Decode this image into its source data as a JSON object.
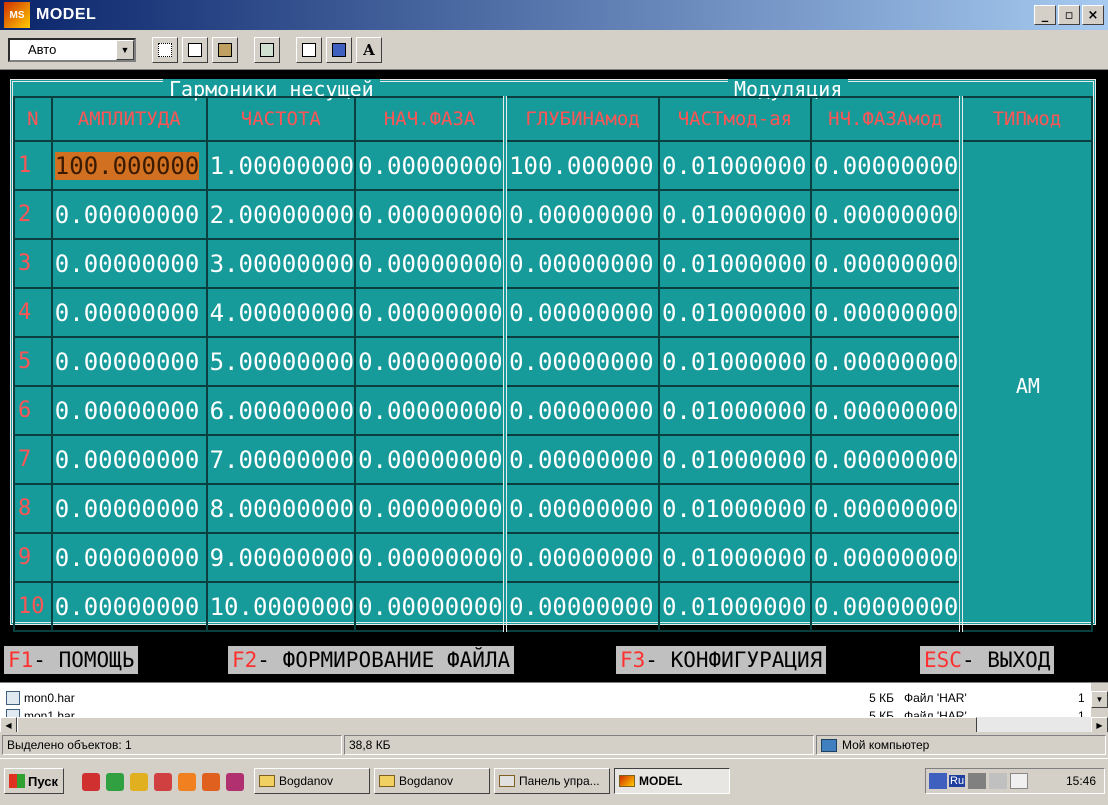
{
  "window": {
    "title": "MODEL",
    "icon_text": "MS"
  },
  "toolbar": {
    "font_value": "Авто",
    "buttons": [
      "mark-icon",
      "copy-icon",
      "paste-icon",
      "fullscreen-icon",
      "properties-icon",
      "background-icon",
      "font-icon"
    ],
    "font_btn_label": "A"
  },
  "screen": {
    "group_carrier": "Гармоники несущей",
    "group_mod": "Модуляция",
    "headers": {
      "n": "N",
      "amp": "АМПЛИТУДА",
      "freq": "ЧАСТОТА",
      "phase": "НАЧ.ФАЗА",
      "depth": "ГЛУБИНАмод",
      "modfreq": "ЧАСТмод-ая",
      "modphase": "НЧ.ФАЗАмод",
      "type": "ТИПмод"
    },
    "rows": [
      {
        "n": "1",
        "amp": "100.000000",
        "freq": "1.00000000",
        "phase": "0.00000000",
        "depth": "100.000000",
        "modfreq": "0.01000000",
        "modphase": "0.00000000"
      },
      {
        "n": "2",
        "amp": "0.00000000",
        "freq": "2.00000000",
        "phase": "0.00000000",
        "depth": "0.00000000",
        "modfreq": "0.01000000",
        "modphase": "0.00000000"
      },
      {
        "n": "3",
        "amp": "0.00000000",
        "freq": "3.00000000",
        "phase": "0.00000000",
        "depth": "0.00000000",
        "modfreq": "0.01000000",
        "modphase": "0.00000000"
      },
      {
        "n": "4",
        "amp": "0.00000000",
        "freq": "4.00000000",
        "phase": "0.00000000",
        "depth": "0.00000000",
        "modfreq": "0.01000000",
        "modphase": "0.00000000"
      },
      {
        "n": "5",
        "amp": "0.00000000",
        "freq": "5.00000000",
        "phase": "0.00000000",
        "depth": "0.00000000",
        "modfreq": "0.01000000",
        "modphase": "0.00000000"
      },
      {
        "n": "6",
        "amp": "0.00000000",
        "freq": "6.00000000",
        "phase": "0.00000000",
        "depth": "0.00000000",
        "modfreq": "0.01000000",
        "modphase": "0.00000000"
      },
      {
        "n": "7",
        "amp": "0.00000000",
        "freq": "7.00000000",
        "phase": "0.00000000",
        "depth": "0.00000000",
        "modfreq": "0.01000000",
        "modphase": "0.00000000"
      },
      {
        "n": "8",
        "amp": "0.00000000",
        "freq": "8.00000000",
        "phase": "0.00000000",
        "depth": "0.00000000",
        "modfreq": "0.01000000",
        "modphase": "0.00000000"
      },
      {
        "n": "9",
        "amp": "0.00000000",
        "freq": "9.00000000",
        "phase": "0.00000000",
        "depth": "0.00000000",
        "modfreq": "0.01000000",
        "modphase": "0.00000000"
      },
      {
        "n": "10",
        "amp": "0.00000000",
        "freq": "10.0000000",
        "phase": "0.00000000",
        "depth": "0.00000000",
        "modfreq": "0.01000000",
        "modphase": "0.00000000"
      }
    ],
    "type_value": "AM",
    "fkeys": [
      {
        "key": "F1",
        "label": " - ПОМОЩЬ"
      },
      {
        "key": "F2",
        "label": " - ФОРМИРОВАНИЕ ФАЙЛА"
      },
      {
        "key": "F3",
        "label": " - КОНФИГУРАЦИЯ"
      },
      {
        "key": "ESC",
        "label": " - ВЫХОД"
      }
    ]
  },
  "files": [
    {
      "name": "mon0.har",
      "size": "5 КБ",
      "type": "Файл 'HAR'",
      "date": "1"
    },
    {
      "name": "mon1.har",
      "size": "5 КБ",
      "type": "Файл 'HAR'",
      "date": "1"
    }
  ],
  "status": {
    "selected": "Выделено объектов: 1",
    "size": "38,8 КБ",
    "location": "Мой компьютер"
  },
  "taskbar": {
    "start": "Пуск",
    "tasks": [
      "Bogdanov",
      "Bogdanov",
      "Панель упра...",
      "MODEL"
    ],
    "tray_lang": "Ru",
    "clock": "15:46"
  },
  "colors": {
    "dos_bg": "#169a9a",
    "header_text": "#ff5555",
    "selected_cell": "#d07020",
    "titlebar": "#0a246a"
  }
}
